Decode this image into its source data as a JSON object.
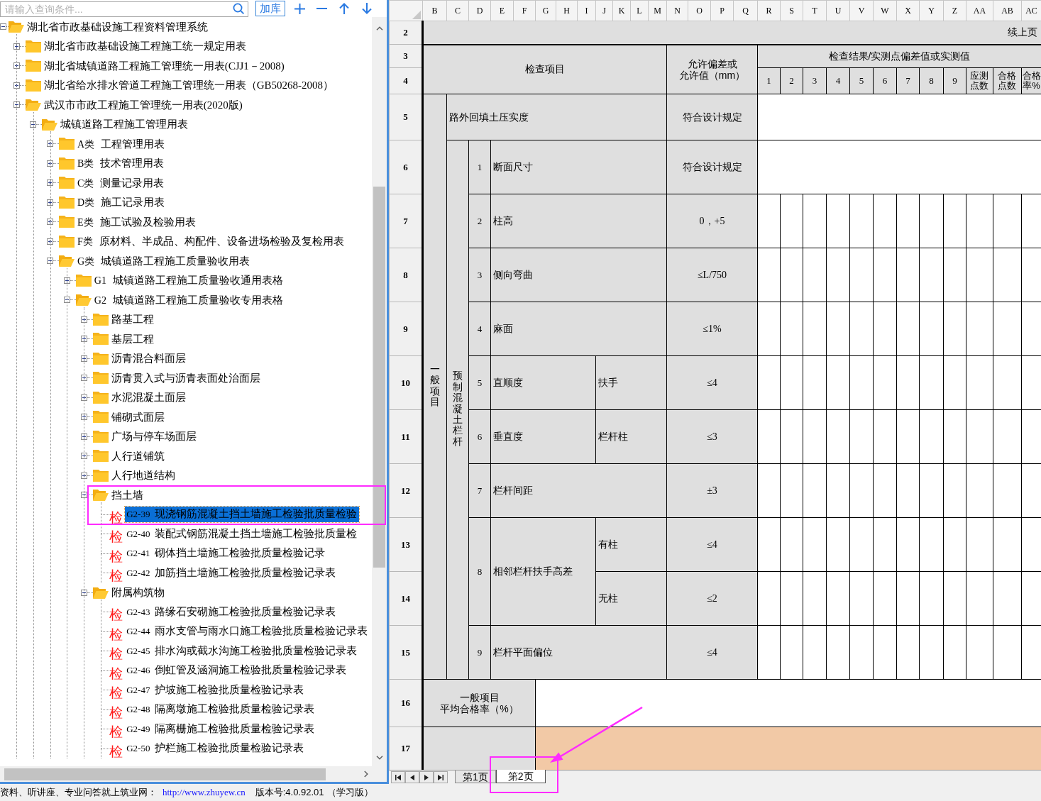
{
  "toolbar": {
    "search": {
      "placeholder": "请输入查询条件..."
    },
    "add_button": {
      "label": "加库"
    }
  },
  "tree": {
    "items": [
      {
        "kind": "folder",
        "label": "湖北省市政基础设施工程资料管理系统",
        "expanded": true,
        "selected": false,
        "children": [
          {
            "kind": "folder",
            "label": "湖北省市政基础设施工程施工统一规定用表",
            "expanded": false,
            "selected": false
          },
          {
            "kind": "folder",
            "label": "湖北省城镇道路工程施工管理统一用表(CJJ1－2008)",
            "expanded": false,
            "selected": false
          },
          {
            "kind": "folder",
            "label": "湖北省给水排水管道工程施工管理统一用表（GB50268-2008）",
            "expanded": false,
            "selected": false
          },
          {
            "kind": "folder",
            "label": "武汉市市政工程施工管理统一用表(2020版)",
            "expanded": true,
            "selected": false,
            "children": [
              {
                "kind": "folder",
                "label": "城镇道路工程施工管理用表",
                "expanded": true,
                "selected": false,
                "children": [
                  {
                    "kind": "folder",
                    "prefix": "A类",
                    "label": "工程管理用表",
                    "expanded": false,
                    "selected": false
                  },
                  {
                    "kind": "folder",
                    "prefix": "B类",
                    "label": "技术管理用表",
                    "expanded": false,
                    "selected": false
                  },
                  {
                    "kind": "folder",
                    "prefix": "C类",
                    "label": "测量记录用表",
                    "expanded": false,
                    "selected": false
                  },
                  {
                    "kind": "folder",
                    "prefix": "D类",
                    "label": "施工记录用表",
                    "expanded": false,
                    "selected": false
                  },
                  {
                    "kind": "folder",
                    "prefix": "E类",
                    "label": "施工试验及检验用表",
                    "expanded": false,
                    "selected": false
                  },
                  {
                    "kind": "folder",
                    "prefix": "F类",
                    "label": "原材料、半成品、构配件、设备进场检验及复检用表",
                    "expanded": false,
                    "selected": false
                  },
                  {
                    "kind": "folder",
                    "prefix": "G类",
                    "label": "城镇道路工程施工质量验收用表",
                    "expanded": true,
                    "selected": false,
                    "children": [
                      {
                        "kind": "folder",
                        "prefix": "G1",
                        "label": "城镇道路工程施工质量验收通用表格",
                        "expanded": false,
                        "selected": false
                      },
                      {
                        "kind": "folder",
                        "prefix": "G2",
                        "label": "城镇道路工程施工质量验收专用表格",
                        "expanded": true,
                        "selected": false,
                        "children": [
                          {
                            "kind": "folder",
                            "label": "路基工程",
                            "expanded": false,
                            "selected": false
                          },
                          {
                            "kind": "folder",
                            "label": "基层工程",
                            "expanded": false,
                            "selected": false
                          },
                          {
                            "kind": "folder",
                            "label": "沥青混合料面层",
                            "expanded": false,
                            "selected": false
                          },
                          {
                            "kind": "folder",
                            "label": "沥青贯入式与沥青表面处治面层",
                            "expanded": false,
                            "selected": false
                          },
                          {
                            "kind": "folder",
                            "label": "水泥混凝土面层",
                            "expanded": false,
                            "selected": false
                          },
                          {
                            "kind": "folder",
                            "label": "铺砌式面层",
                            "expanded": false,
                            "selected": false
                          },
                          {
                            "kind": "folder",
                            "label": "广场与停车场面层",
                            "expanded": false,
                            "selected": false
                          },
                          {
                            "kind": "folder",
                            "label": "人行道铺筑",
                            "expanded": false,
                            "selected": false
                          },
                          {
                            "kind": "folder",
                            "label": "人行地道结构",
                            "expanded": false,
                            "selected": false
                          },
                          {
                            "kind": "folder",
                            "label": "挡土墙",
                            "expanded": true,
                            "selected": false,
                            "children": [
                              {
                                "kind": "document",
                                "mark": "检",
                                "code": "G2-39",
                                "title": "现浇钢筋混凝土挡土墙施工检验批质量检验",
                                "selected": true
                              },
                              {
                                "kind": "document",
                                "mark": "检",
                                "code": "G2-40",
                                "title": "装配式钢筋混凝土挡土墙施工检验批质量检",
                                "selected": false
                              },
                              {
                                "kind": "document",
                                "mark": "检",
                                "code": "G2-41",
                                "title": "砌体挡土墙施工检验批质量检验记录",
                                "selected": false
                              },
                              {
                                "kind": "document",
                                "mark": "检",
                                "code": "G2-42",
                                "title": "加筋挡土墙施工检验批质量检验记录表",
                                "selected": false
                              }
                            ]
                          },
                          {
                            "kind": "folder",
                            "label": "附属构筑物",
                            "expanded": true,
                            "selected": false,
                            "children": [
                              {
                                "kind": "document",
                                "mark": "检",
                                "code": "G2-43",
                                "title": "路缘石安砌施工检验批质量检验记录表",
                                "selected": false
                              },
                              {
                                "kind": "document",
                                "mark": "检",
                                "code": "G2-44",
                                "title": "雨水支管与雨水口施工检验批质量检验记录表",
                                "selected": false
                              },
                              {
                                "kind": "document",
                                "mark": "检",
                                "code": "G2-45",
                                "title": "排水沟或截水沟施工检验批质量检验记录表",
                                "selected": false
                              },
                              {
                                "kind": "document",
                                "mark": "检",
                                "code": "G2-46",
                                "title": "倒虹管及涵洞施工检验批质量检验记录表",
                                "selected": false
                              },
                              {
                                "kind": "document",
                                "mark": "检",
                                "code": "G2-47",
                                "title": "护坡施工检验批质量检验记录表",
                                "selected": false
                              },
                              {
                                "kind": "document",
                                "mark": "检",
                                "code": "G2-48",
                                "title": "隔离墩施工检验批质量检验记录表",
                                "selected": false
                              },
                              {
                                "kind": "document",
                                "mark": "检",
                                "code": "G2-49",
                                "title": "隔离栅施工检验批质量检验记录表",
                                "selected": false
                              },
                              {
                                "kind": "document",
                                "mark": "检",
                                "code": "G2-50",
                                "title": "护栏施工检验批质量检验记录表",
                                "selected": false
                              }
                            ]
                          }
                        ]
                      }
                    ]
                  }
                ]
              }
            ]
          }
        ]
      }
    ]
  },
  "sheet": {
    "columns": [
      "B",
      "C",
      "D",
      "E",
      "F",
      "G",
      "H",
      "I",
      "J",
      "K",
      "L",
      "M",
      "N",
      "O",
      "P",
      "Q",
      "R",
      "S",
      "T",
      "U",
      "V",
      "W",
      "X",
      "Y",
      "Z",
      "AA",
      "AB",
      "AC"
    ],
    "row_numbers": [
      "2",
      "3",
      "4",
      "5",
      "6",
      "7",
      "8",
      "9",
      "10",
      "11",
      "12",
      "13",
      "14",
      "15",
      "16",
      "17"
    ],
    "continued": "续上页",
    "header": {
      "item": "检查项目",
      "tolerance": [
        "允许偏差或",
        "允许值（mm）"
      ],
      "results": "检查结果/实测点偏差值或实测值",
      "points": [
        "1",
        "2",
        "3",
        "4",
        "5",
        "6",
        "7",
        "8",
        "9"
      ],
      "extra": [
        "应测点数",
        "合格点数",
        "合格率%"
      ]
    },
    "general": {
      "label": "一般项目",
      "first": {
        "name": "路外回填土压实度",
        "tolerance": "符合设计规定",
        "kind": "merged"
      },
      "group": {
        "label": "预制混凝土栏杆",
        "items": [
          {
            "no": "1",
            "name": "断面尺寸",
            "tolerance": "符合设计规定",
            "kind": "merged"
          },
          {
            "no": "2",
            "name": "柱高",
            "tolerance": "0，+5",
            "kind": "cells"
          },
          {
            "no": "3",
            "name": "侧向弯曲",
            "tolerance": "≤L/750",
            "kind": "cells"
          },
          {
            "no": "4",
            "name": "麻面",
            "tolerance": "≤1%",
            "kind": "cells"
          },
          {
            "no": "5",
            "name": "直顺度",
            "parts": [
              {
                "part": "扶手",
                "tolerance": "≤4"
              }
            ],
            "kind": "cells"
          },
          {
            "no": "6",
            "name": "垂直度",
            "parts": [
              {
                "part": "栏杆柱",
                "tolerance": "≤3"
              }
            ],
            "kind": "cells"
          },
          {
            "no": "7",
            "name": "栏杆间距",
            "tolerance": "±3",
            "kind": "cells"
          },
          {
            "no": "8",
            "name": "相邻栏杆扶手高差",
            "parts": [
              {
                "part": "有柱",
                "tolerance": "≤4"
              },
              {
                "part": "无柱",
                "tolerance": "≤2"
              }
            ],
            "kind": "cells"
          },
          {
            "no": "9",
            "name": "栏杆平面偏位",
            "tolerance": "≤4",
            "kind": "cells"
          }
        ]
      }
    },
    "summary": {
      "lines": [
        "一般项目",
        "平均合格率（%）"
      ]
    }
  },
  "sheet_tabs": [
    {
      "label": "第1页",
      "selected": false
    },
    {
      "label": "第2页",
      "selected": true
    }
  ],
  "status_bar": {
    "text": "资料、听讲座、专业问答就上筑业网：",
    "link": "http://www.zhuyew.cn",
    "version": "版本号:4.0.92.01",
    "edition": "（学习版）"
  }
}
